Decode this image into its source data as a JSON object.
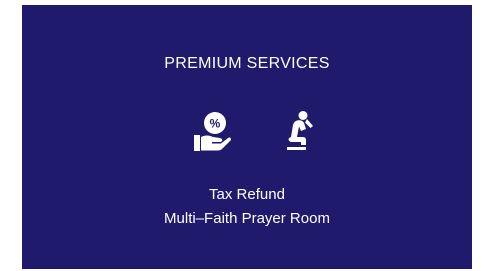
{
  "section": {
    "title": "PREMIUM SERVICES",
    "icons": [
      "tax-refund-icon",
      "prayer-icon"
    ],
    "services": [
      "Tax Refund",
      "Multi–Faith Prayer Room"
    ]
  },
  "colors": {
    "panel_background": "#1f1a6b",
    "text": "#ffffff"
  }
}
